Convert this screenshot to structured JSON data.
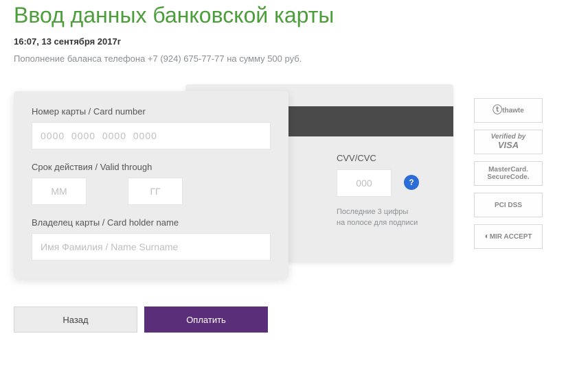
{
  "title": "Ввод данных банковской карты",
  "timestamp": "16:07, 13 сентября 2017г",
  "description": "Пополнение баланса телефона +7 (924) 675-77-77 на сумму 500 руб.",
  "card_front": {
    "number_label": "Номер карты / Card number",
    "number_placeholder": "0000  0000  0000  0000",
    "expiry_label": "Срок действия / Valid through",
    "mm_placeholder": "ММ",
    "yy_placeholder": "ГГ",
    "holder_label": "Владелец карты / Card holder name",
    "holder_placeholder": "Имя Фамилия / Name Surname"
  },
  "card_back": {
    "cvv_label": "CVV/CVC",
    "cvv_placeholder": "000",
    "cvv_help": "?",
    "hint1": "Последние 3 цифры",
    "hint2": "на полосе для подписи"
  },
  "badges": {
    "thawte": "thawte",
    "vbv_line1": "Verified by",
    "vbv_line2": "VISA",
    "msc_line1": "MasterCard.",
    "msc_line2": "SecureCode.",
    "pci": "PCI DSS",
    "mir": "MIR ACCEPT"
  },
  "buttons": {
    "back": "Назад",
    "pay": "Оплатить"
  }
}
